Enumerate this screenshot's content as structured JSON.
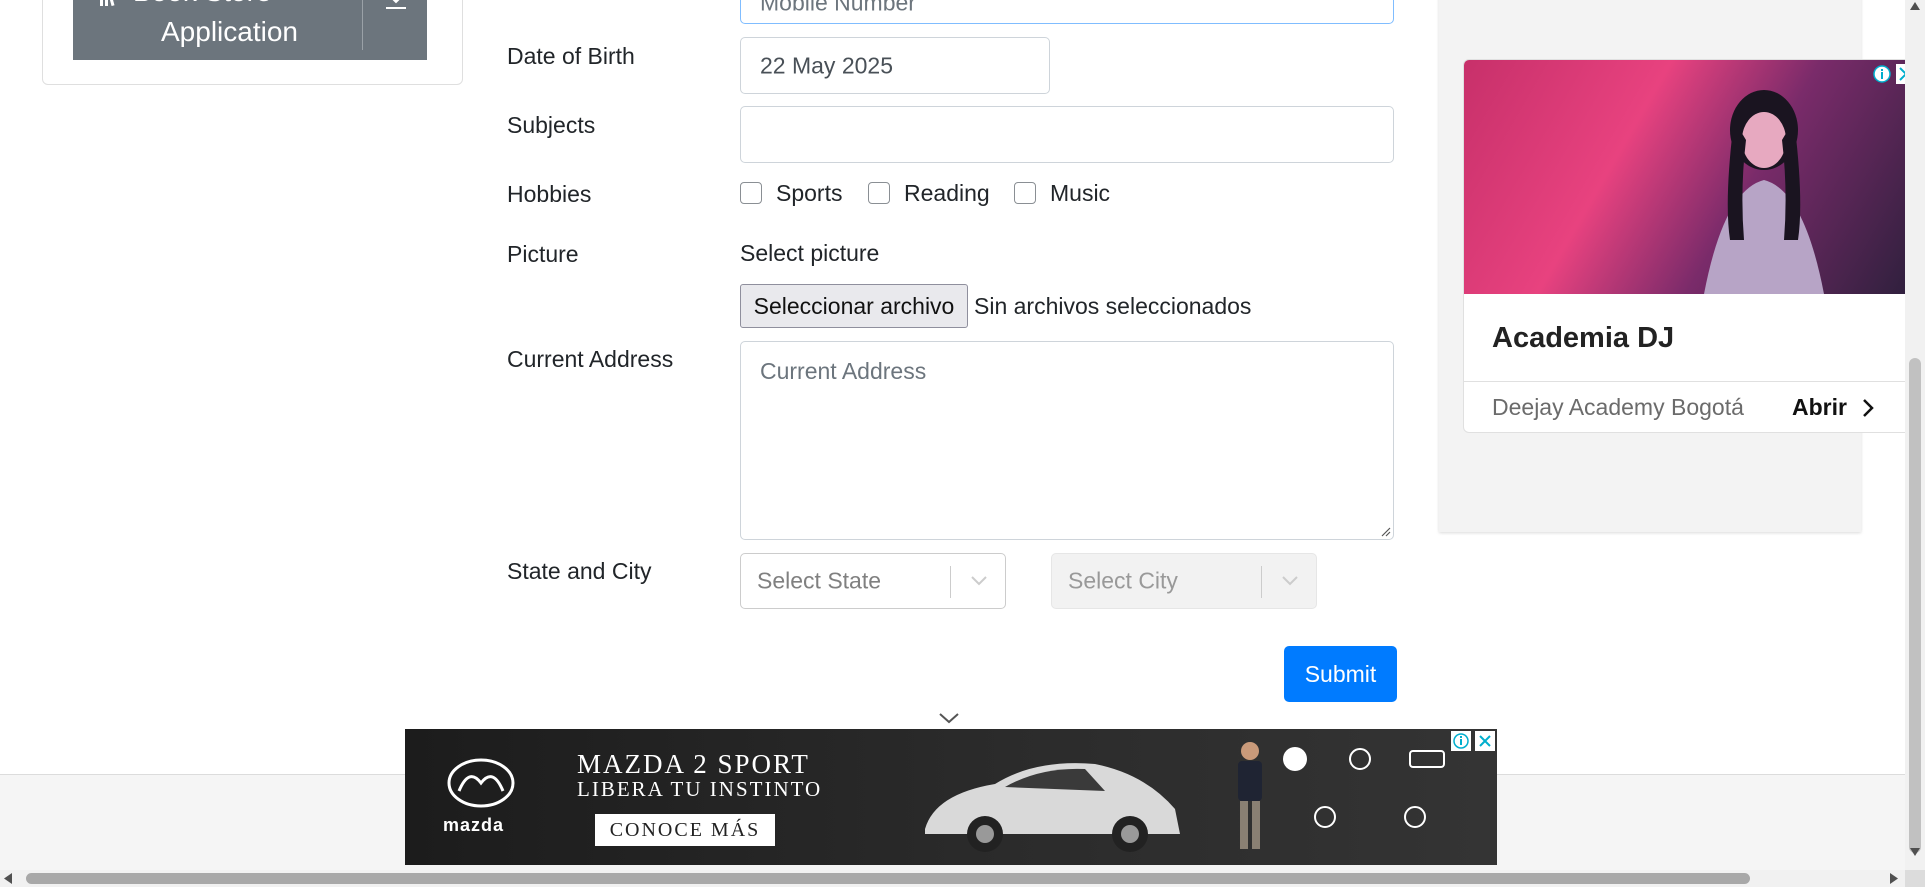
{
  "sidebar": {
    "banner_line1": "Book Store",
    "banner_line2": "Application"
  },
  "form": {
    "mobile_placeholder": "Mobile Number",
    "dob_label": "Date of Birth",
    "dob_value": "22 May 2025",
    "subjects_label": "Subjects",
    "hobbies_label": "Hobbies",
    "hobbies": [
      "Sports",
      "Reading",
      "Music"
    ],
    "picture_label": "Picture",
    "select_picture": "Select picture",
    "file_button": "Seleccionar archivo",
    "file_status": "Sin archivos seleccionados",
    "address_label": "Current Address",
    "address_placeholder": "Current Address",
    "state_city_label": "State and City",
    "state_placeholder": "Select State",
    "city_placeholder": "Select City",
    "submit": "Submit"
  },
  "right_ad": {
    "title": "Academia DJ",
    "subtitle": "Deejay Academy Bogotá",
    "cta": "Abrir"
  },
  "bottom_ad": {
    "brand": "mazda",
    "headline1": "MAZDA 2 SPORT",
    "headline2": "LIBERA TU INSTINTO",
    "cta": "CONOCE MÁS"
  },
  "colors": {
    "primary": "#007bff",
    "banner": "#6c757d"
  }
}
